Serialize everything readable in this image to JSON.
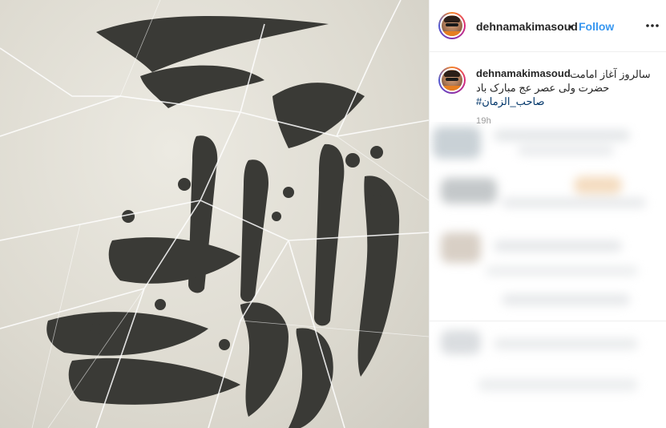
{
  "post": {
    "username": "dehnamakimasoud",
    "separator": "•",
    "follow_label": "Follow",
    "more_icon": "more-options-icon"
  },
  "caption": {
    "username": "dehnamakimasoud",
    "line1": "سالروز آغاز امامت",
    "line2": "حضرت ولی عصر عج مبارک باد",
    "hashtag": "#صاحب_الزمان",
    "timestamp": "19h"
  },
  "colors": {
    "link": "#3897f0",
    "hashtag": "#003569",
    "text": "#262626",
    "muted": "#999999",
    "image_bg": "#dddad0",
    "calligraphy": "#3a3a36"
  }
}
